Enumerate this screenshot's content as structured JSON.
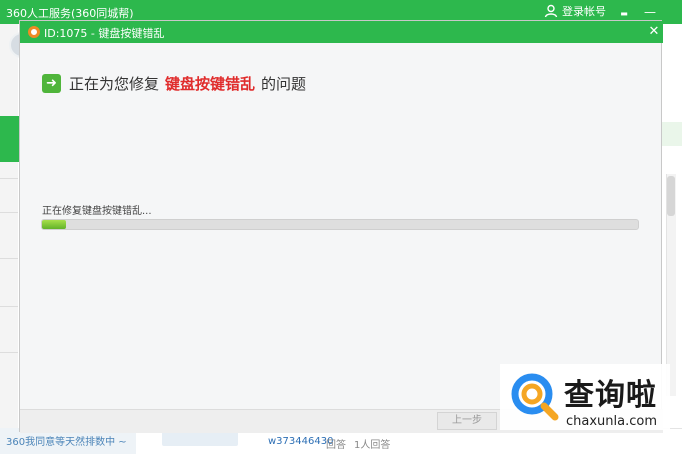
{
  "app": {
    "title": "360人工服务(360同城帮)",
    "login_label": "登录帐号",
    "menu_glyph": "▬",
    "minimize_glyph": "—"
  },
  "background": {
    "bottom_link": "360我同意等天然排数中 ~",
    "user_name": "w373446430",
    "answer_label": "回答",
    "answered_count": "1人回答"
  },
  "dialog": {
    "title": "ID:1075 - 键盘按键错乱",
    "close_glyph": "✕",
    "heading_prefix": "正在为您修复",
    "heading_highlight": "键盘按键错乱",
    "heading_suffix": "的问题",
    "status_text": "正在修复键盘按键错乱...",
    "progress_percent": 4,
    "prev_button": "上一步"
  },
  "watermark": {
    "name": "查询啦",
    "url": "chaxunla.com"
  },
  "colors": {
    "brand_green": "#2db84d",
    "highlight_red": "#e02c2c",
    "progress_green": "#61b329",
    "watermark_blue": "#2a8df0",
    "watermark_orange": "#f5a623"
  },
  "icons": {
    "login": "user-icon",
    "menu": "menu-icon",
    "minimize": "minimize-icon",
    "dialog_logo": "lifebuoy-icon",
    "heading": "arrow-right-icon",
    "watermark": "search-magnifier-icon"
  }
}
